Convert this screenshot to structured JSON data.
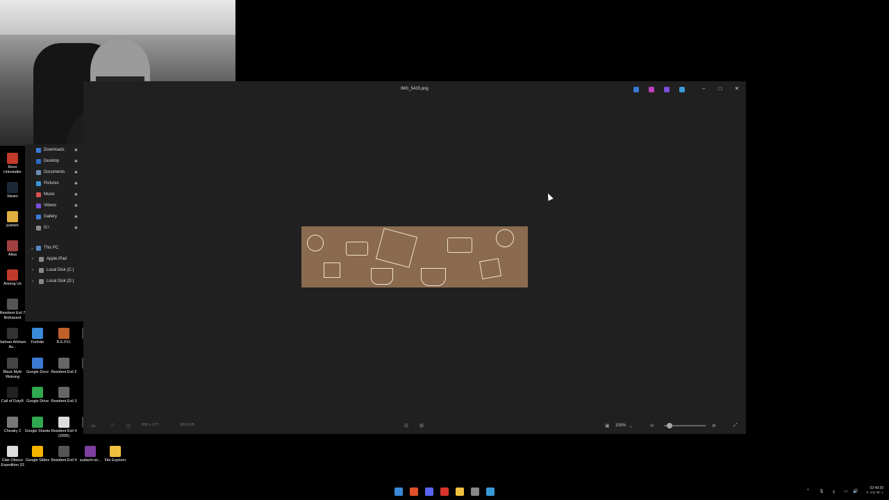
{
  "nav": {
    "items": [
      {
        "label": "Downloads",
        "icon": "download-icon",
        "color": "#3a7bd5",
        "pinned": true
      },
      {
        "label": "Desktop",
        "icon": "desktop-icon",
        "color": "#2b6cc4",
        "pinned": true
      },
      {
        "label": "Documents",
        "icon": "documents-icon",
        "color": "#6d8fb5",
        "pinned": true
      },
      {
        "label": "Pictures",
        "icon": "pictures-icon",
        "color": "#3a9ad9",
        "pinned": true
      },
      {
        "label": "Music",
        "icon": "music-icon",
        "color": "#d9534f",
        "pinned": true
      },
      {
        "label": "Videos",
        "icon": "videos-icon",
        "color": "#7b4fd9",
        "pinned": true
      },
      {
        "label": "Gallery",
        "icon": "gallery-icon",
        "color": "#3a7bd5",
        "pinned": true
      },
      {
        "label": "G:\\",
        "icon": "drive-icon",
        "color": "#888888",
        "pinned": true
      }
    ],
    "this_pc": "This PC",
    "pc_items": [
      {
        "label": "Apple iPad",
        "icon": "ipad-icon"
      },
      {
        "label": "Local Disk (C:)",
        "icon": "disk-icon"
      },
      {
        "label": "Local Disk (D:)",
        "icon": "disk-icon"
      }
    ]
  },
  "desktop_icons": [
    {
      "label": "Revo Uninstaller",
      "icon": "revo-icon",
      "color": "#c0392b"
    },
    {
      "label": "Steam",
      "icon": "steam-icon",
      "color": "#1b2838"
    },
    {
      "label": "publish",
      "icon": "folder-icon",
      "color": "#e0b040"
    },
    {
      "label": "Alisa",
      "icon": "alisa-icon",
      "color": "#a04040"
    },
    {
      "label": "Among Us",
      "icon": "among-us-icon",
      "color": "#c0392b"
    },
    {
      "label": "Resident Evil 7 Biohazard",
      "icon": "re7-icon",
      "color": "#555555"
    },
    {
      "label": "Batman Arkham As...",
      "icon": "batman-icon",
      "color": "#333333"
    },
    {
      "label": "Fortnite",
      "icon": "fortnite-icon",
      "color": "#3a8ad9"
    },
    {
      "label": "R.E.P.O.",
      "icon": "repo-icon",
      "color": "#c0602b"
    },
    {
      "label": "Re",
      "icon": "re-icon",
      "color": "#444444"
    },
    {
      "label": "Black Myth Wukong",
      "icon": "wukong-icon",
      "color": "#444444"
    },
    {
      "label": "Google Docs",
      "icon": "docs-icon",
      "color": "#3a7bd5"
    },
    {
      "label": "Resident Evil 2",
      "icon": "re2-icon",
      "color": "#666666"
    },
    {
      "label": "S Vi",
      "icon": "s-vi-icon",
      "color": "#444444"
    },
    {
      "label": "Call of Duty®",
      "icon": "cod-icon",
      "color": "#222222"
    },
    {
      "label": "Google Drive",
      "icon": "drive-app-icon",
      "color": "#2fa84f"
    },
    {
      "label": "Resident Evil 3",
      "icon": "re3-icon",
      "color": "#666666"
    },
    {
      "label": "Chivalry 2",
      "icon": "chivalry-icon",
      "color": "#777777"
    },
    {
      "label": "Google Sheets",
      "icon": "sheets-icon",
      "color": "#2fa84f"
    },
    {
      "label": "Resident Evil 4 (2005)",
      "icon": "re4-icon",
      "color": "#dddddd"
    },
    {
      "label": "S",
      "icon": "s-icon",
      "color": "#444444"
    },
    {
      "label": "Clair Obscur Expedition 33",
      "icon": "clair-icon",
      "color": "#dddddd"
    },
    {
      "label": "Google Slides",
      "icon": "slides-icon",
      "color": "#f4b400"
    },
    {
      "label": "Resident Evil 4",
      "icon": "re4b-icon",
      "color": "#555555"
    },
    {
      "label": "sudachi-wi...",
      "icon": "winrar-icon",
      "color": "#7b3fa0"
    },
    {
      "label": "File Explorer",
      "icon": "folder-icon",
      "color": "#f0c040"
    }
  ],
  "window": {
    "title": "IMG_5415.png",
    "toolbar_icons": [
      {
        "name": "edit-icon",
        "color": "#3a7bd5"
      },
      {
        "name": "clipchamp-icon",
        "color": "#c040c0"
      },
      {
        "name": "designer-icon",
        "color": "#7b4fd9"
      },
      {
        "name": "onedrive-icon",
        "color": "#3a9ad9"
      }
    ],
    "controls": {
      "minimize": "–",
      "maximize": "□",
      "close": "✕"
    },
    "image_accent": "#8a6b4f",
    "bottom": {
      "dimensions": "656 x 177",
      "size": "89.9 KB",
      "zoom": "100%"
    }
  },
  "taskbar": {
    "apps": [
      {
        "name": "start-icon",
        "color": "#3a8ad9"
      },
      {
        "name": "brave-icon",
        "color": "#e0502b"
      },
      {
        "name": "discord-icon",
        "color": "#5865f2"
      },
      {
        "name": "acrobat-icon",
        "color": "#d9342b"
      },
      {
        "name": "file-explorer-icon",
        "color": "#f0c040"
      },
      {
        "name": "obs-icon",
        "color": "#888888"
      },
      {
        "name": "photos-icon",
        "color": "#3a9ad9"
      }
    ],
    "tray": {
      "lang": "ع",
      "time": "02:49:30",
      "date": "٢٠٢٦/٠٣/٠١"
    }
  }
}
